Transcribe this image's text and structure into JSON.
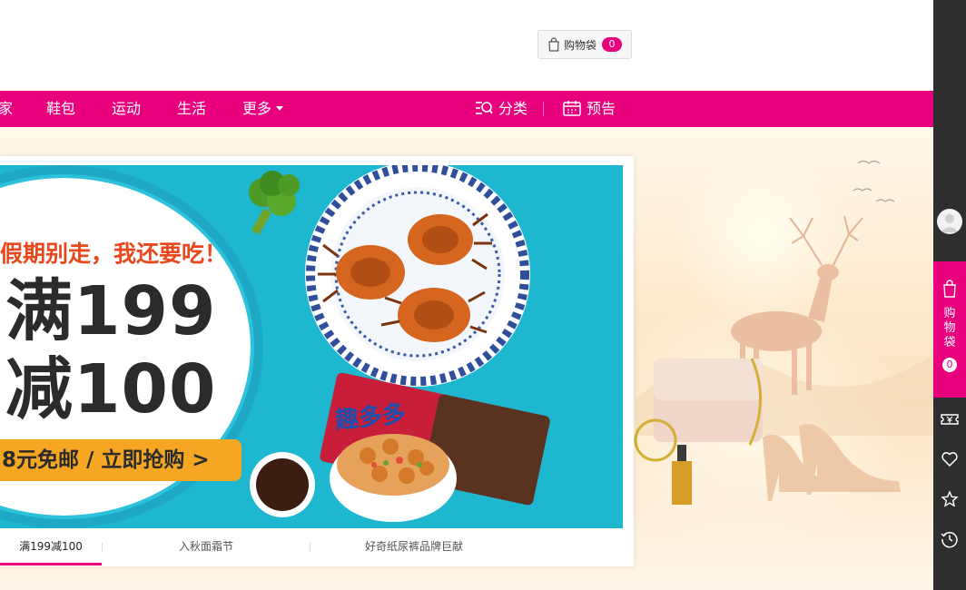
{
  "header": {
    "cart_label": "购物袋",
    "cart_count": "0"
  },
  "nav": {
    "items": [
      "家",
      "鞋包",
      "运动",
      "生活",
      "更多"
    ],
    "category_label": "分类",
    "preview_label": "预告"
  },
  "promo": {
    "tagline": "假期别走，我还要吃！",
    "line1": "满199",
    "line2": "减100",
    "cta": "8元免邮 / 立即抢购 >",
    "product_name": "趣多多"
  },
  "promo_tabs": [
    {
      "label": "满199减100",
      "active": true
    },
    {
      "label": "入秋面霜节",
      "active": false
    },
    {
      "label": "好奇纸尿裤品牌巨献",
      "active": false
    }
  ],
  "sidebar": {
    "cart_label": "购物袋",
    "cart_count": "0"
  },
  "colors": {
    "brand_pink": "#e8007d",
    "promo_cyan": "#1db7d0",
    "cta_orange": "#f5a623",
    "sidebar_dark": "#2e2e2e"
  }
}
